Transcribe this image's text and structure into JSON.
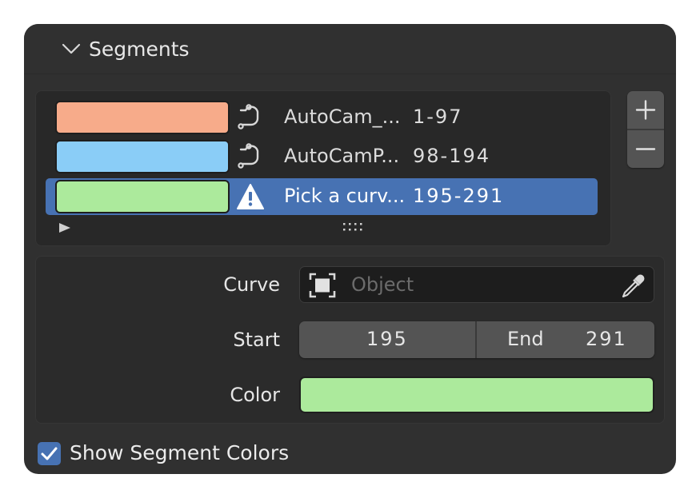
{
  "panel": {
    "title": "Segments"
  },
  "segments": [
    {
      "name": "AutoCam_...",
      "range": "1-97",
      "color": "#f7ab8a",
      "icon": "curve-icon",
      "active": false
    },
    {
      "name": "AutoCamP...",
      "range": "98-194",
      "color": "#8acdf7",
      "icon": "curve-icon",
      "active": false
    },
    {
      "name": "Pick a curv...",
      "range": "195-291",
      "color": "#acea9c",
      "icon": "warning-icon",
      "active": true
    }
  ],
  "list_controls": {
    "add_icon": "plus-icon",
    "remove_icon": "minus-icon"
  },
  "properties": {
    "curve_label": "Curve",
    "curve_placeholder": "Object",
    "start_label": "Start",
    "start_value": "195",
    "end_label": "End",
    "end_value": "291",
    "color_label": "Color",
    "color_value": "#acea9c"
  },
  "footer": {
    "show_colors_label": "Show Segment Colors",
    "show_colors_checked": true
  },
  "colors": {
    "accent": "#4772b3",
    "panel_bg": "#303030"
  }
}
